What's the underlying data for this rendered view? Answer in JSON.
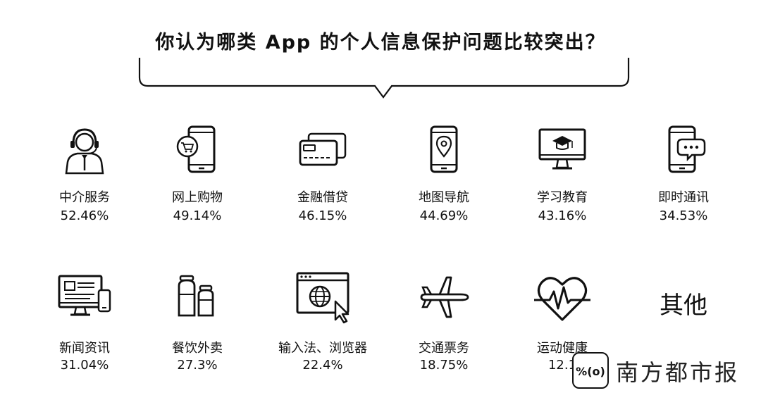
{
  "chart_data": {
    "type": "table",
    "title": "你认为哪类 App 的个人信息保护问题比较突出？",
    "items": [
      {
        "category": "中介服务",
        "display": "52.46%",
        "value": 52.46,
        "icon": "customer-service-headset-icon"
      },
      {
        "category": "网上购物",
        "display": "49.14%",
        "value": 49.14,
        "icon": "phone-shopping-cart-icon"
      },
      {
        "category": "金融借贷",
        "display": "46.15%",
        "value": 46.15,
        "icon": "credit-cards-icon"
      },
      {
        "category": "地图导航",
        "display": "44.69%",
        "value": 44.69,
        "icon": "phone-map-pin-icon"
      },
      {
        "category": "学习教育",
        "display": "43.16%",
        "value": 43.16,
        "icon": "monitor-graduation-cap-icon"
      },
      {
        "category": "即时通讯",
        "display": "34.53%",
        "value": 34.53,
        "icon": "phone-chat-bubble-icon"
      },
      {
        "category": "新闻资讯",
        "display": "31.04%",
        "value": 31.04,
        "icon": "monitor-news-phone-icon"
      },
      {
        "category": "餐饮外卖",
        "display": "27.3%",
        "value": 27.3,
        "icon": "food-jars-icon"
      },
      {
        "category": "输入法、浏览器",
        "display": "22.4%",
        "value": 22.4,
        "icon": "browser-globe-cursor-icon"
      },
      {
        "category": "交通票务",
        "display": "18.75%",
        "value": 18.75,
        "icon": "airplane-icon"
      },
      {
        "category": "运动健康",
        "display": "12.1",
        "value": 12.1,
        "icon": "heart-pulse-icon"
      }
    ],
    "other_label": "其他"
  },
  "watermark": {
    "logo_text": "%(o)",
    "text": "南方都市报"
  },
  "colors": {
    "ink": "#111111",
    "background": "#ffffff"
  }
}
